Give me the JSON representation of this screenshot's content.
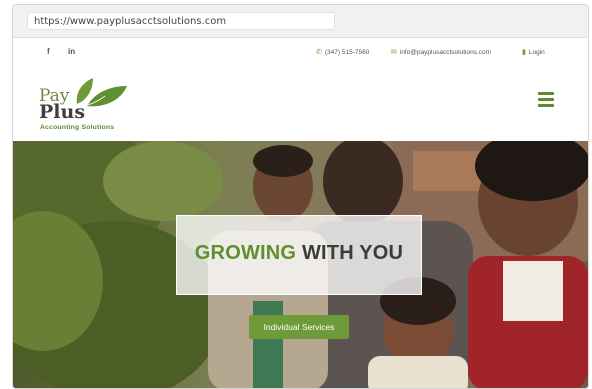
{
  "browser": {
    "url": "https://www.payplusacctsolutions.com"
  },
  "topbar": {
    "social": [
      "f",
      "in"
    ],
    "phone": "(347) 515-7560",
    "email": "info@payplusacctsolutions.com",
    "login": "Login"
  },
  "logo": {
    "line1": "Pay",
    "line2": "Plus",
    "tagline": "Accounting Solutions"
  },
  "hero": {
    "headline_green": "GROWING",
    "headline_dark": " WITH YOU",
    "cta": "Individual Services"
  },
  "colors": {
    "brand_green": "#6f9a3a",
    "headline_green": "#5f8f30",
    "text_dark": "#3b3b3b"
  },
  "icons": {
    "phone": "phone-icon",
    "email": "envelope-icon",
    "login": "lock-icon",
    "menu": "hamburger-menu-icon"
  }
}
